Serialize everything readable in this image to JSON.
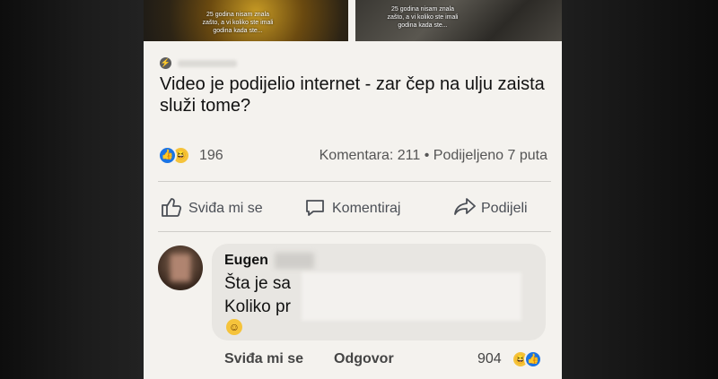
{
  "thumbnails": [
    {
      "caption": "25 godina nisam znala zašto, a vi koliko ste imali godina kada ste..."
    },
    {
      "caption": "25 godina nisam znala zašto, a vi koliko ste imali godina kada ste..."
    }
  ],
  "post": {
    "title": "Video je podijelio internet - zar čep na ulju zaista služi tome?",
    "reaction_count": "196",
    "comments_shares": "Komentara: 211 • Podijeljeno 7 puta"
  },
  "actions": {
    "like": "Sviđa mi se",
    "comment": "Komentiraj",
    "share": "Podijeli"
  },
  "comment": {
    "author": "Eugen",
    "line1": "Šta je sa",
    "line2": "Koliko pr",
    "emoji": "☺",
    "like_label": "Sviđa mi se",
    "reply_label": "Odgovor",
    "reaction_count": "904"
  },
  "icons": {
    "like": "thumbs-up-icon",
    "haha": "laughing-emoji-icon",
    "comment": "speech-bubble-icon",
    "share": "share-arrow-icon"
  },
  "colors": {
    "like_blue": "#1b74e4",
    "haha_yellow": "#f5c33b",
    "card_bg": "#f4f2ee"
  }
}
